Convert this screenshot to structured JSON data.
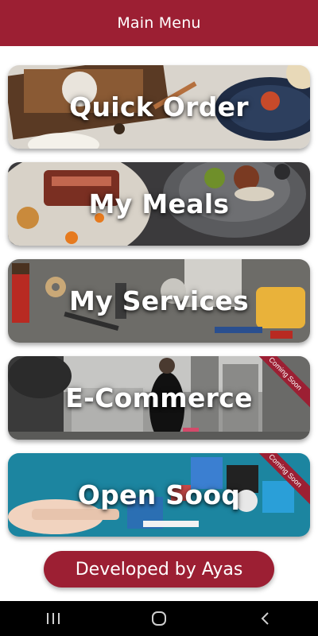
{
  "header": {
    "title": "Main Menu"
  },
  "menu": {
    "items": [
      {
        "label": "Quick Order",
        "ribbon": ""
      },
      {
        "label": "My Meals",
        "ribbon": ""
      },
      {
        "label": "My Services",
        "ribbon": ""
      },
      {
        "label": "E-Commerce",
        "ribbon": "Coming Soon"
      },
      {
        "label": "Open Sooq",
        "ribbon": "Coming Soon"
      }
    ]
  },
  "footer": {
    "developer_label": "Developed by Ayas"
  },
  "colors": {
    "brand": "#9c1f33",
    "navbar": "#000000"
  },
  "navbar": {
    "icons": [
      "recent-apps-icon",
      "home-icon",
      "back-icon"
    ]
  }
}
